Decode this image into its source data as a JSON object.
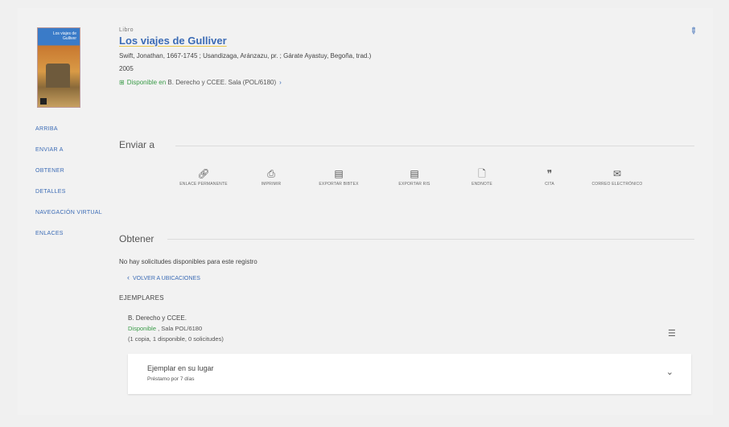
{
  "record": {
    "type": "Libro",
    "title": "Los viajes de Gulliver",
    "authors": "Swift, Jonathan, 1667-1745 ; Usandizaga, Aránzazu, pr. ; Gárate Ayastuy, Begoña, trad.)",
    "year": "2005",
    "availability_status": "Disponible en",
    "availability_location": " B. Derecho y CCEE.  Sala (POL/6180)",
    "cover_title": "Los viajes de Gulliver"
  },
  "nav": [
    "ARRIBA",
    "ENVIAR A",
    "OBTENER",
    "DETALLES",
    "NAVEGACIÓN VIRTUAL",
    "ENLACES"
  ],
  "send_to": {
    "heading": "Enviar a",
    "actions": [
      {
        "label": "ENLACE PERMANENTE",
        "icon": "link-icon"
      },
      {
        "label": "IMPRIMIR",
        "icon": "print-icon"
      },
      {
        "label": "EXPORTAR BIBTEX",
        "icon": "bibtex-icon"
      },
      {
        "label": "EXPORTAR RIS",
        "icon": "ris-icon"
      },
      {
        "label": "ENDNOTE",
        "icon": "endnote-icon"
      },
      {
        "label": "CITA",
        "icon": "quote-icon"
      },
      {
        "label": "CORREO ELECTRÓNICO",
        "icon": "email-icon"
      }
    ]
  },
  "obtain": {
    "heading": "Obtener",
    "message": "No hay solicitudes disponibles para este registro",
    "back_link": "VOLVER A UBICACIONES",
    "copies_heading": "EJEMPLARES",
    "location": {
      "name": "B. Derecho y CCEE.",
      "status": "Disponible",
      "shelf": " , Sala POL/6180",
      "copies": "(1 copia, 1 disponible, 0 solicitudes)"
    },
    "item": {
      "title": "Ejemplar en su lugar",
      "loan": "Préstamo por 7 días"
    }
  },
  "colors": {
    "link": "#3b6bb5",
    "available": "#3a9b48",
    "highlight_underline": "#e8c54a"
  }
}
